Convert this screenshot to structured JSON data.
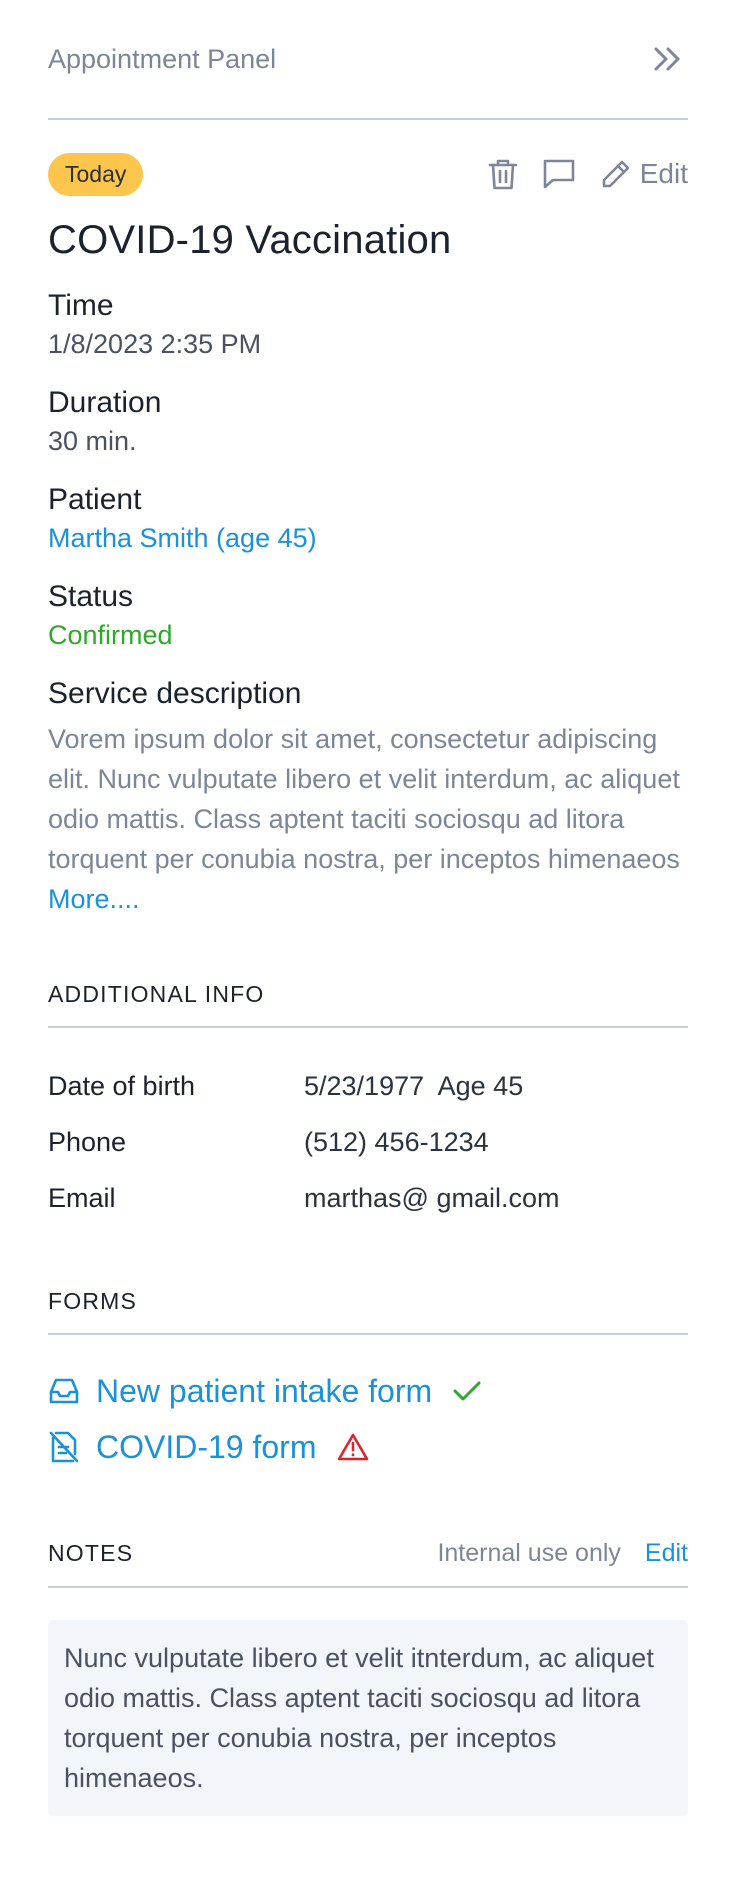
{
  "header": {
    "title": "Appointment Panel",
    "collapse_icon": "double-chevron-right-icon"
  },
  "appointment": {
    "badge": "Today",
    "actions": {
      "delete_icon": "trash-icon",
      "message_icon": "chat-icon",
      "edit_label": "Edit"
    },
    "title": "COVID-19 Vaccination",
    "time_label": "Time",
    "time_value": "1/8/2023 2:35 PM",
    "duration_label": "Duration",
    "duration_value": "30 min.",
    "patient_label": "Patient",
    "patient_value": "Martha Smith (age 45)",
    "status_label": "Status",
    "status_value": "Confirmed",
    "description_label": "Service description",
    "description_text": "Vorem ipsum dolor sit amet, consectetur adipiscing elit. Nunc vulputate libero et velit interdum, ac aliquet odio mattis. Class aptent taciti sociosqu ad litora torquent per conubia nostra, per inceptos himenaeos",
    "description_more": "More...."
  },
  "additional_info": {
    "heading": "ADDITIONAL INFO",
    "rows": [
      {
        "label": "Date of birth",
        "value": "5/23/1977  Age 45"
      },
      {
        "label": "Phone",
        "value": "(512) 456-1234"
      },
      {
        "label": "Email",
        "value": "marthas@ gmail.com"
      }
    ]
  },
  "forms": {
    "heading": "FORMS",
    "items": [
      {
        "label": "New patient intake form",
        "icon": "inbox-icon",
        "status_icon": "checkmark-icon"
      },
      {
        "label": "COVID-19 form",
        "icon": "file-off-icon",
        "status_icon": "warning-icon"
      }
    ]
  },
  "notes": {
    "heading": "NOTES",
    "internal_label": "Internal use only",
    "edit_label": "Edit",
    "text": "Nunc vulputate libero et velit itnterdum, ac aliquet odio mattis. Class aptent taciti sociosqu ad litora torquent per conubia nostra, per inceptos himenaeos."
  },
  "colors": {
    "accent": "#1a91d8",
    "badge": "#fcc54c",
    "success": "#2fa82b",
    "danger": "#d9262c",
    "muted": "#7c8699"
  }
}
